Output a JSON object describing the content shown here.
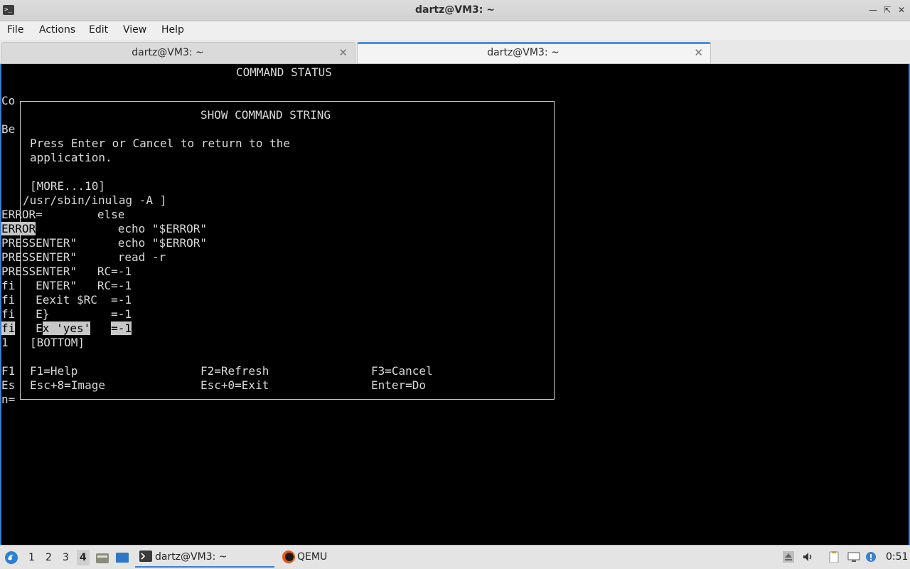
{
  "window": {
    "title": "dartz@VM3: ~"
  },
  "menu": [
    "File",
    "Actions",
    "Edit",
    "View",
    "Help"
  ],
  "tabs": [
    {
      "label": "dartz@VM3: ~",
      "active": false
    },
    {
      "label": "dartz@VM3: ~",
      "active": true
    }
  ],
  "terminal": {
    "header": "COMMAND STATUS",
    "bg_left": [
      "Co",
      "Be"
    ],
    "dialog": {
      "title": "SHOW COMMAND STRING",
      "message_1": "Press Enter or Cancel to return to the",
      "message_2": "application.",
      "more": "[MORE...10]",
      "cmd": "/usr/sbin/inulag -A ]",
      "bottom": "[BOTTOM]"
    },
    "lines": {
      "l1": "ERROR=        else",
      "l2_hl": "ERROR",
      "l2_rest": "            echo \"$ERROR\"",
      "l3": "PRESSENTER\"      echo \"$ERROR\"",
      "l4": "PRESSENTER\"      read -r",
      "l5": "PRESSENTER\"   RC=-1",
      "l6": "fi   ENTER\"   RC=-1",
      "l7": "fi   Eexit $RC  =-1",
      "l8": "fi   E}         =-1",
      "l9_a": "fi",
      "l9_b": "   E",
      "l9_c": "x 'yes'",
      "l9_d": "   ",
      "l9_e": "=-1",
      "l10": "1"
    },
    "keys": {
      "f1_bg": "F1",
      "esc_bg": "Es",
      "n_bg": "n=",
      "help": "F1=Help",
      "refresh": "F2=Refresh",
      "cancel": "F3=Cancel",
      "image": "Esc+8=Image",
      "exit": "Esc+0=Exit",
      "do": "Enter=Do"
    }
  },
  "taskbar": {
    "desktops": [
      "1",
      "2",
      "3",
      "4"
    ],
    "active_desktop": "4",
    "tasks": [
      {
        "label": "dartz@VM3: ~",
        "icon": "terminal-icon"
      },
      {
        "label": "QEMU",
        "icon": "qemu-icon"
      }
    ],
    "clock": "0:51"
  },
  "colors": {
    "accent": "#3b7fd1",
    "terminal_bg": "#000000",
    "terminal_fg": "#d9d9d9"
  }
}
